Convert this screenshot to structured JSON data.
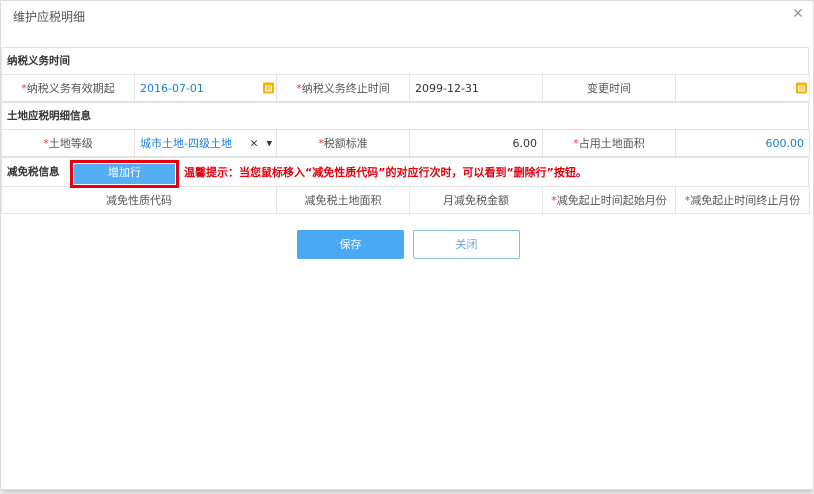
{
  "dialog": {
    "title": "维护应税明细"
  },
  "section1": {
    "title": "纳税义务时间",
    "start_label": "纳税义务有效期起",
    "start_value": "2016-07-01",
    "end_label": "纳税义务终止时间",
    "end_value": "2099-12-31",
    "change_label": "变更时间",
    "change_value": ""
  },
  "section2": {
    "title": "土地应税明细信息",
    "grade_label": "土地等级",
    "grade_value": "城市土地-四级土地",
    "clear_glyph": "×",
    "arrow_glyph": "▼",
    "rate_label": "税额标准",
    "rate_value": "6.00",
    "area_label": "占用土地面积",
    "area_value": "600.00"
  },
  "section3": {
    "title": "减免税信息",
    "add_button": "增加行",
    "tip": "温馨提示：当您鼠标移入“减免性质代码”的对应行次时，可以看到“删除行”按钮。",
    "columns": [
      "减免性质代码",
      "减免税土地面积",
      "月减免税金额",
      "减免起止时间起始月份",
      "减免起止时间终止月份"
    ],
    "required_columns": [
      false,
      false,
      false,
      true,
      true
    ]
  },
  "buttons": {
    "save": "保存",
    "close": "关闭"
  },
  "icons": {
    "close": "close-icon",
    "calendar": "calendar-icon"
  },
  "colors": {
    "accent": "#4aa9f2",
    "required": "#e33333",
    "highlight_border": "#e4000f",
    "calendar": "#f0b400"
  }
}
